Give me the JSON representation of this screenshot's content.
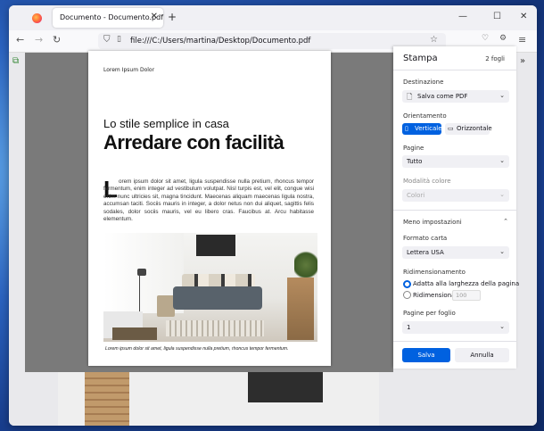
{
  "browser": {
    "tab_title": "Documento - Documento.pdf",
    "url": "file:///C:/Users/martina/Desktop/Documento.pdf"
  },
  "document": {
    "header": "Lorem Ipsum Dolor",
    "subtitle": "Lo stile semplice in casa",
    "title": "Arredare con facilità",
    "dropcap": "L",
    "body": "orem ipsum dolor sit amet, ligula suspendisse nulla pretium, rhoncus tempor fermentum, enim integer ad vestibulum volutpat. Nisl turpis est, vel elit, congue wisi enim nunc ultricies sit, magna tincidunt. Maecenas aliquam maecenas ligula nostra, accumsan taciti. Sociis mauris in integer, a dolor netus non dui aliquet, sagittis felis sodales, dolor sociis mauris, vel eu libero cras. Faucibus at. Arcu habitasse elementum.",
    "caption": "Lorem ipsum dolor sit amet, ligula suspendisse nulla pretium, rhoncus tempor fermentum."
  },
  "print_panel": {
    "title": "Stampa",
    "sheets": "2 fogli",
    "destination_label": "Destinazione",
    "destination_value": "Salva come PDF",
    "orientation_label": "Orientamento",
    "orientation_vertical": "Verticale",
    "orientation_horizontal": "Orizzontale",
    "pages_label": "Pagine",
    "pages_value": "Tutto",
    "color_label": "Modalità colore",
    "color_value": "Colori",
    "less_settings": "Meno impostazioni",
    "paper_label": "Formato carta",
    "paper_value": "Lettera USA",
    "scale_label": "Ridimensionamento",
    "scale_fit": "Adatta alla larghezza della pagina",
    "scale_custom": "Ridimensiona",
    "scale_value": "100",
    "pps_label": "Pagine per foglio",
    "pps_value": "1",
    "print_button": "Salva",
    "cancel_button": "Annulla"
  },
  "colors": {
    "accent": "#0061e0"
  }
}
